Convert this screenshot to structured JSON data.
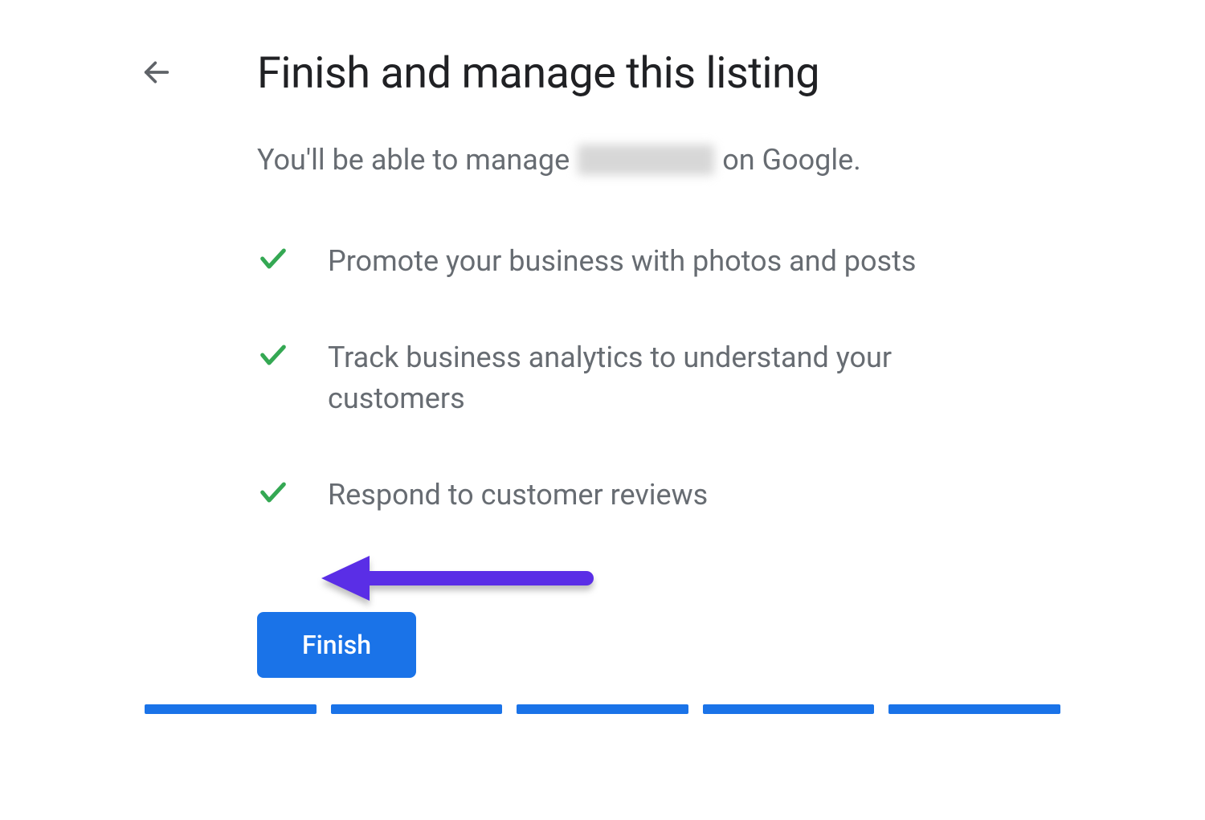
{
  "header": {
    "title": "Finish and manage this listing"
  },
  "subtitle": {
    "prefix": "You'll be able to manage",
    "redacted_business_name": "",
    "suffix": "on Google."
  },
  "bullets": [
    {
      "text": "Promote your business with photos and posts"
    },
    {
      "text": "Track business analytics to understand your customers"
    },
    {
      "text": "Respond to customer reviews"
    }
  ],
  "actions": {
    "finish_label": "Finish"
  },
  "progress": {
    "segments": 5,
    "completed": 5
  },
  "annotation": {
    "arrow_color": "#5a2ee6"
  },
  "colors": {
    "primary": "#1a73e8",
    "check": "#34a853",
    "text_muted": "#676c72"
  }
}
